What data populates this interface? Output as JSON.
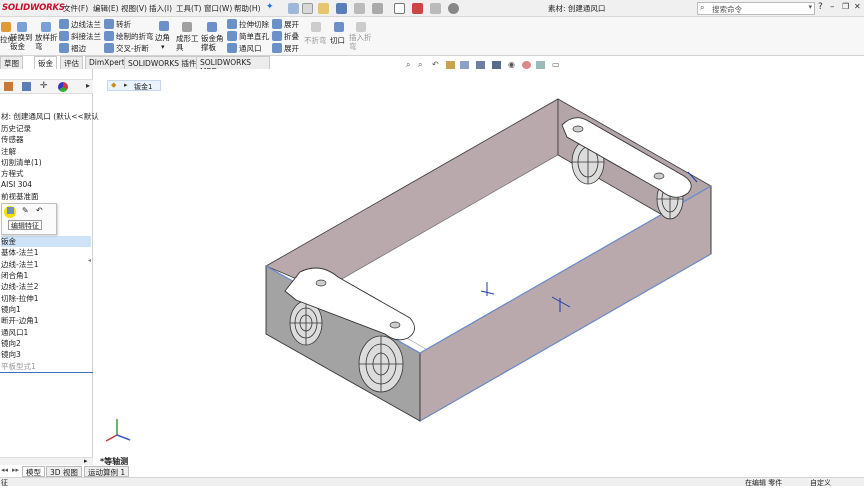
{
  "app": {
    "logo": "SOLIDWORKS",
    "menus": [
      "文件(F)",
      "编辑(E)",
      "视图(V)",
      "插入(I)",
      "工具(T)",
      "窗口(W)",
      "帮助(H)"
    ],
    "document_title": "素材: 创建通风口",
    "search_placeholder": "搜索命令",
    "window_controls": [
      "?",
      "–",
      "❐",
      "✕"
    ]
  },
  "command_manager": {
    "left_partial": [
      "拉伸",
      "转换到钣金",
      "放样折弯",
      "边线法兰",
      "斜接法兰",
      "褶边",
      "转折",
      "绘制的折弯",
      "交叉-折断",
      "边角",
      "成形工具",
      "钣金角撑板",
      "拉伸切除",
      "简单直孔",
      "通风口",
      "展开",
      "折叠",
      "展开",
      "不折弯",
      "切口",
      "插入折弯"
    ],
    "buttons": [
      {
        "label": "边线法兰"
      },
      {
        "label": "斜接法兰"
      },
      {
        "label": "褶边"
      },
      {
        "label": "转折"
      },
      {
        "label": "绘制的折弯"
      },
      {
        "label": "交叉-折断"
      },
      {
        "label": "边角"
      },
      {
        "label": "成形工\n具"
      },
      {
        "label": "钣金角\n撑板"
      },
      {
        "label": "拉伸切除"
      },
      {
        "label": "简单直孔"
      },
      {
        "label": "通风口"
      },
      {
        "label": "展开"
      },
      {
        "label": "折叠"
      },
      {
        "label": "展开"
      },
      {
        "label": "不折弯"
      },
      {
        "label": "切口"
      },
      {
        "label": "插入折\n弯"
      }
    ],
    "left_labels": [
      "拉伸",
      "转换到\n钣金",
      "放样折\n弯"
    ]
  },
  "tabs": [
    "草图",
    "钣金",
    "评估",
    "DimXpert",
    "SOLIDWORKS 插件",
    "SOLIDWORKS MBD"
  ],
  "active_tab": "钣金",
  "feature_tree": {
    "root": "材: 创建通风口 (默认<<默认",
    "items": [
      "历史记录",
      "传感器",
      "注解",
      "切割清单(1)",
      "方程式",
      "AISI 304",
      "前视基准面",
      "钣金",
      "基体-法兰1",
      "边线-法兰1",
      "闭合角1",
      "边线-法兰2",
      "切除-拉伸1",
      "镜向1",
      "断开-边角1",
      "通风口1",
      "镜向2",
      "镜向3",
      "平板型式1"
    ],
    "tooltip": "编辑特征",
    "selected": "钣金"
  },
  "breadcrumb": "钣金1",
  "view_label": "*等轴测",
  "bottom_tabs": [
    "模型",
    "3D 视图",
    "运动算例 1"
  ],
  "status": {
    "left": "征",
    "mode": "在编辑 零件",
    "units": "自定义"
  },
  "colors": {
    "box_face": "#b9a9ad",
    "box_side": "#9c9c9c",
    "edge": "#333333",
    "selected_edge": "#6a8fd6",
    "highlight": "#f5e000"
  }
}
